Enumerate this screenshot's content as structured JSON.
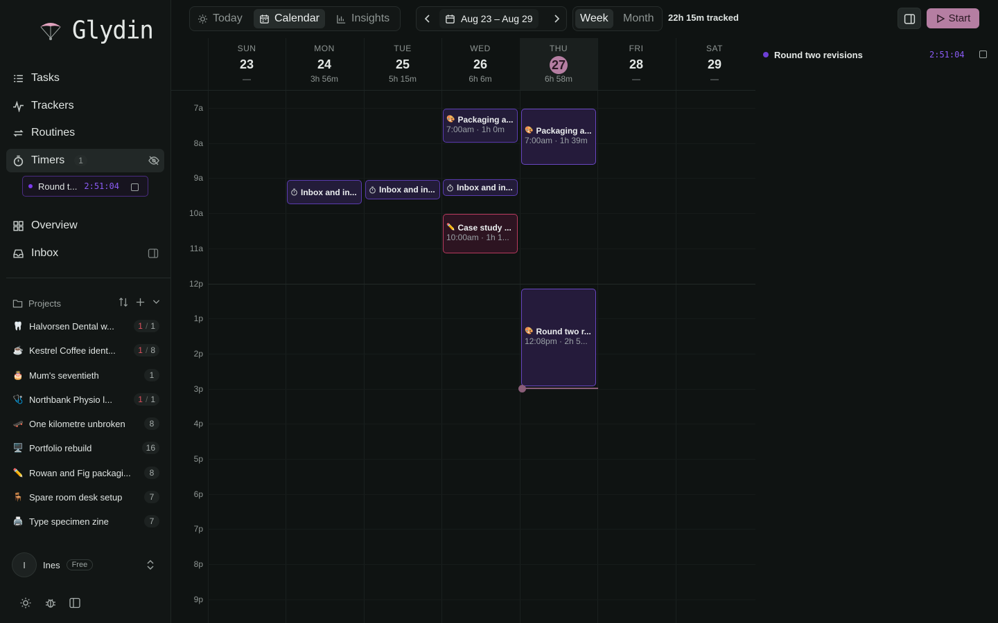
{
  "app": {
    "name": "Glydin"
  },
  "nav": {
    "tasks": "Tasks",
    "trackers": "Trackers",
    "routines": "Routines",
    "timers": "Timers",
    "timers_count": "1",
    "overview": "Overview",
    "inbox": "Inbox"
  },
  "active_timer": {
    "label": "Round t...",
    "time": "2:51:04"
  },
  "projects": {
    "heading": "Projects",
    "items": [
      {
        "emoji": "🦷",
        "name": "Halvorsen Dental w...",
        "done": "1",
        "total": "1"
      },
      {
        "emoji": "☕",
        "name": "Kestrel Coffee ident...",
        "done": "1",
        "total": "8"
      },
      {
        "emoji": "🎂",
        "name": "Mum's seventieth",
        "done": "",
        "total": "1"
      },
      {
        "emoji": "🩺",
        "name": "Northbank Physio l...",
        "done": "1",
        "total": "1"
      },
      {
        "emoji": "🛹",
        "name": "One kilometre unbroken",
        "done": "",
        "total": "8"
      },
      {
        "emoji": "🖥️",
        "name": "Portfolio rebuild",
        "done": "",
        "total": "16"
      },
      {
        "emoji": "✏️",
        "name": "Rowan and Fig packagi...",
        "done": "",
        "total": "8"
      },
      {
        "emoji": "🪑",
        "name": "Spare room desk setup",
        "done": "",
        "total": "7"
      },
      {
        "emoji": "🖨️",
        "name": "Type specimen zine",
        "done": "",
        "total": "7"
      }
    ]
  },
  "user": {
    "initial": "I",
    "name": "Ines",
    "plan": "Free"
  },
  "toolbar": {
    "today": "Today",
    "calendar": "Calendar",
    "insights": "Insights",
    "range": "Aug 23 – Aug 29",
    "week": "Week",
    "month": "Month",
    "tracked": "22h 15m tracked",
    "start": "Start"
  },
  "days": [
    {
      "name": "SUN",
      "num": "23",
      "sum": "—"
    },
    {
      "name": "MON",
      "num": "24",
      "sum": "3h 56m"
    },
    {
      "name": "TUE",
      "num": "25",
      "sum": "5h 15m"
    },
    {
      "name": "WED",
      "num": "26",
      "sum": "6h 6m"
    },
    {
      "name": "THU",
      "num": "27",
      "sum": "6h 58m",
      "today": true
    },
    {
      "name": "FRI",
      "num": "28",
      "sum": "—"
    },
    {
      "name": "SAT",
      "num": "29",
      "sum": "—"
    }
  ],
  "hours": [
    "7a",
    "8a",
    "9a",
    "10a",
    "11a",
    "12p",
    "1p",
    "2p",
    "3p",
    "4p",
    "5p",
    "6p",
    "7p",
    "8p",
    "9p"
  ],
  "events": [
    {
      "title": "Packaging a...",
      "sub": "7:00am · 1h 0m",
      "emoji": "🎨"
    },
    {
      "title": "Packaging a...",
      "sub": "7:00am · 1h 39m",
      "emoji": "🎨"
    },
    {
      "title": "Inbox and in...",
      "sub": "",
      "icon": "stopwatch-icon"
    },
    {
      "title": "Inbox and in...",
      "sub": "",
      "icon": "stopwatch-icon"
    },
    {
      "title": "Inbox and in...",
      "sub": "",
      "icon": "stopwatch-icon"
    },
    {
      "title": "Case study ...",
      "sub": "10:00am · 1h 1...",
      "emoji": "✏️"
    },
    {
      "title": "Round two r...",
      "sub": "12:08pm · 2h 5...",
      "emoji": "🎨"
    }
  ],
  "right_panel": {
    "label": "Round two revisions",
    "time": "2:51:04"
  },
  "colors": {
    "accent": "#b57ea2",
    "timer": "#8b5cf6",
    "purple_event": "#5b3cb0",
    "red_event": "#b83a5e"
  }
}
